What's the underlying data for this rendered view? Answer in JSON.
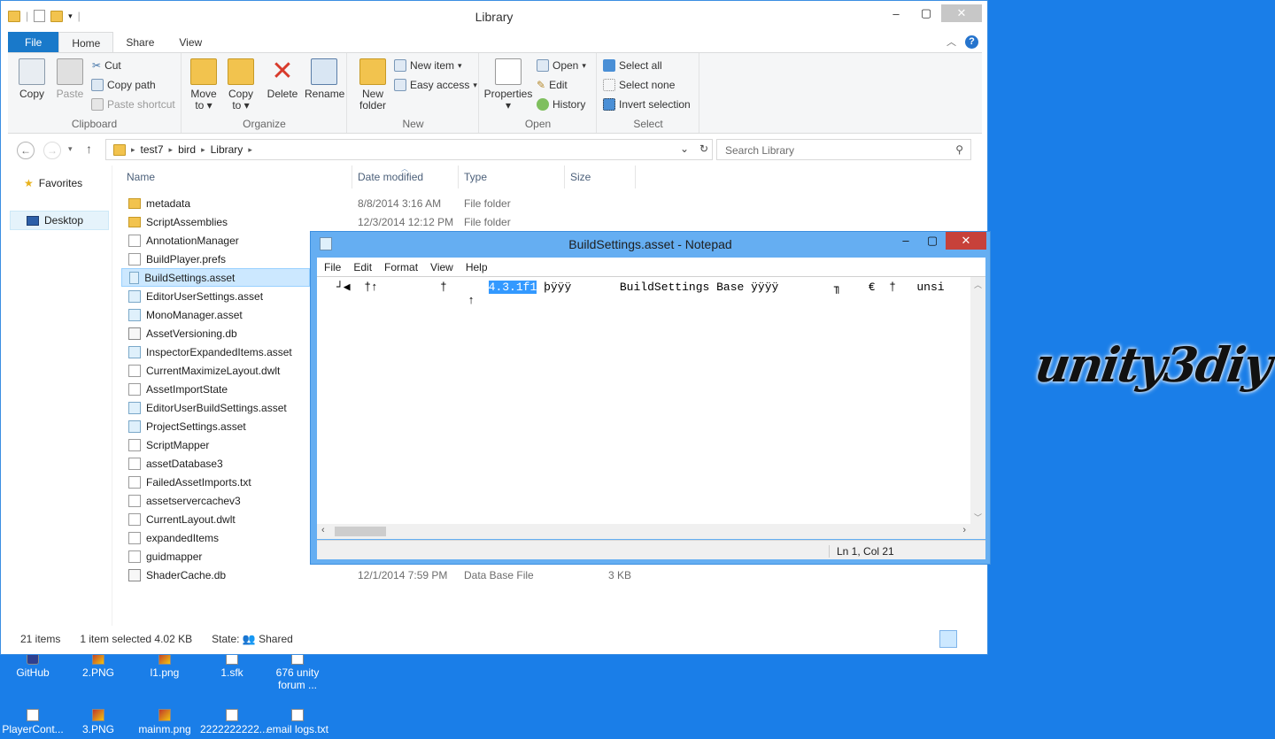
{
  "explorer": {
    "title": "Library",
    "tabs": [
      "File",
      "Home",
      "Share",
      "View"
    ],
    "clipboard": {
      "copy": "Copy",
      "paste": "Paste",
      "cut": "Cut",
      "copy_path": "Copy path",
      "paste_shortcut": "Paste shortcut",
      "label": "Clipboard"
    },
    "organize": {
      "move_to": "Move to",
      "copy_to": "Copy to",
      "delete": "Delete",
      "rename": "Rename",
      "label": "Organize"
    },
    "new": {
      "new_folder": "New folder",
      "new_item": "New item",
      "easy_access": "Easy access",
      "label": "New"
    },
    "open": {
      "properties": "Properties",
      "open": "Open",
      "edit": "Edit",
      "history": "History",
      "label": "Open"
    },
    "select": {
      "select_all": "Select all",
      "select_none": "Select none",
      "invert": "Invert selection",
      "label": "Select"
    },
    "breadcrumb": [
      "test7",
      "bird",
      "Library"
    ],
    "search_placeholder": "Search Library",
    "nav": {
      "favorites": "Favorites",
      "desktop": "Desktop"
    },
    "columns": {
      "name": "Name",
      "date": "Date modified",
      "type": "Type",
      "size": "Size"
    },
    "files": [
      {
        "name": "metadata",
        "date": "8/8/2014 3:16 AM",
        "type": "File folder",
        "size": "",
        "icon": "folder"
      },
      {
        "name": "ScriptAssemblies",
        "date": "12/3/2014 12:12 PM",
        "type": "File folder",
        "size": "",
        "icon": "folder"
      },
      {
        "name": "AnnotationManager",
        "date": "",
        "type": "",
        "size": "",
        "icon": "file"
      },
      {
        "name": "BuildPlayer.prefs",
        "date": "",
        "type": "",
        "size": "",
        "icon": "file"
      },
      {
        "name": "BuildSettings.asset",
        "date": "",
        "type": "",
        "size": "",
        "icon": "asset"
      },
      {
        "name": "EditorUserSettings.asset",
        "date": "",
        "type": "",
        "size": "",
        "icon": "asset"
      },
      {
        "name": "MonoManager.asset",
        "date": "",
        "type": "",
        "size": "",
        "icon": "asset"
      },
      {
        "name": "AssetVersioning.db",
        "date": "",
        "type": "",
        "size": "",
        "icon": "db"
      },
      {
        "name": "InspectorExpandedItems.asset",
        "date": "",
        "type": "",
        "size": "",
        "icon": "asset"
      },
      {
        "name": "CurrentMaximizeLayout.dwlt",
        "date": "",
        "type": "",
        "size": "",
        "icon": "file"
      },
      {
        "name": "AssetImportState",
        "date": "",
        "type": "",
        "size": "",
        "icon": "file"
      },
      {
        "name": "EditorUserBuildSettings.asset",
        "date": "",
        "type": "",
        "size": "",
        "icon": "asset"
      },
      {
        "name": "ProjectSettings.asset",
        "date": "",
        "type": "",
        "size": "",
        "icon": "asset"
      },
      {
        "name": "ScriptMapper",
        "date": "",
        "type": "",
        "size": "",
        "icon": "file"
      },
      {
        "name": "assetDatabase3",
        "date": "",
        "type": "",
        "size": "",
        "icon": "file"
      },
      {
        "name": "FailedAssetImports.txt",
        "date": "",
        "type": "",
        "size": "",
        "icon": "file"
      },
      {
        "name": "assetservercachev3",
        "date": "",
        "type": "",
        "size": "",
        "icon": "file"
      },
      {
        "name": "CurrentLayout.dwlt",
        "date": "",
        "type": "",
        "size": "",
        "icon": "file"
      },
      {
        "name": "expandedItems",
        "date": "",
        "type": "",
        "size": "",
        "icon": "file"
      },
      {
        "name": "guidmapper",
        "date": "",
        "type": "",
        "size": "",
        "icon": "file"
      },
      {
        "name": "ShaderCache.db",
        "date": "12/1/2014 7:59 PM",
        "type": "Data Base File",
        "size": "3 KB",
        "icon": "db"
      }
    ],
    "selected_index": 4,
    "status": {
      "count": "21 items",
      "selected": "1 item selected  4.02 KB",
      "state_label": "State:",
      "state_value": "Shared"
    }
  },
  "notepad": {
    "title": "BuildSettings.asset - Notepad",
    "menu": [
      "File",
      "Edit",
      "Format",
      "View",
      "Help"
    ],
    "line_pre": "┘◀  †↑         †      ",
    "line_sel": "4.3.1f1",
    "line_post": " þÿÿÿ       BuildSettings Base ÿÿÿÿ        ╖    €  †   unsi",
    "line2": "                   ↑",
    "status": "Ln 1, Col 21"
  },
  "desktop": {
    "icons_row1": [
      "GitHub",
      "2.PNG",
      "l1.png",
      "1.sfk",
      "676 unity forum ..."
    ],
    "icons_row2": [
      "PlayerCont...",
      "3.PNG",
      "mainm.png",
      "2222222222...",
      "email logs.txt"
    ],
    "logo": "unity3diy"
  }
}
